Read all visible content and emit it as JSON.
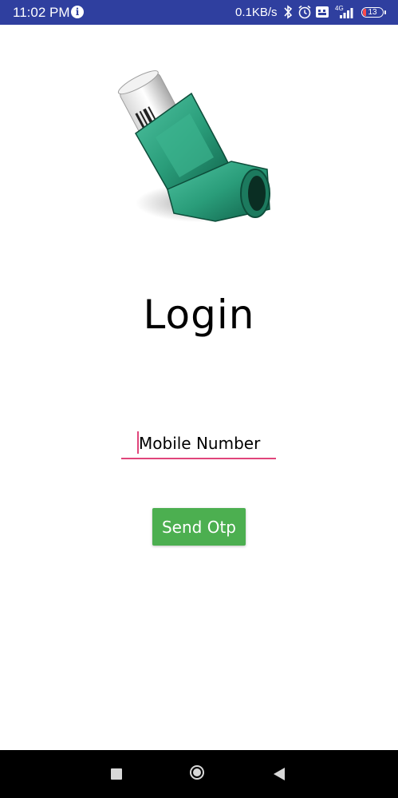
{
  "status_bar": {
    "time": "11:02 PM",
    "net_speed": "0.1KB/s",
    "network_label": "4G",
    "battery_level": "13",
    "icons": [
      "info-icon",
      "bluetooth-icon",
      "alarm-icon",
      "volte-icon",
      "signal-icon",
      "battery-icon"
    ]
  },
  "logo": {
    "icon": "inhaler-icon"
  },
  "login": {
    "title": "Login",
    "mobile_placeholder": "Mobile Number",
    "send_button": "Send Otp"
  },
  "nav_bar": {
    "icons": [
      "recents-icon",
      "home-icon",
      "back-icon"
    ]
  },
  "colors": {
    "status_bar": "#2f3f9f",
    "accent": "#e0457b",
    "button": "#4caf50",
    "inhaler_green": "#2a9d7a"
  }
}
